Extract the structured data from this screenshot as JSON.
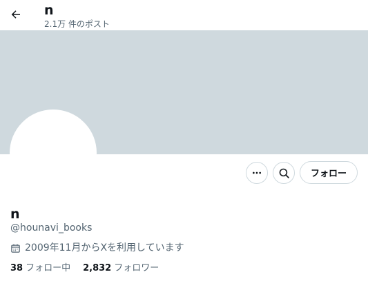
{
  "header": {
    "name": "n",
    "post_count": "2.1万 件のポスト",
    "back_icon": "arrow-left-icon"
  },
  "banner": {
    "color": "#cfd9de"
  },
  "actions": {
    "more_icon": "more-horizontal-icon",
    "search_icon": "search-icon",
    "follow_label": "フォロー"
  },
  "profile": {
    "name": "n",
    "handle": "@hounavi_books",
    "joined": "2009年11月からXを利用しています",
    "joined_icon": "calendar-icon",
    "following_count": "38",
    "following_label": "フォロー中",
    "followers_count": "2,832",
    "followers_label": "フォロワー"
  },
  "colors": {
    "text_primary": "#0f1419",
    "text_secondary": "#536471",
    "border": "#cfd9de"
  }
}
